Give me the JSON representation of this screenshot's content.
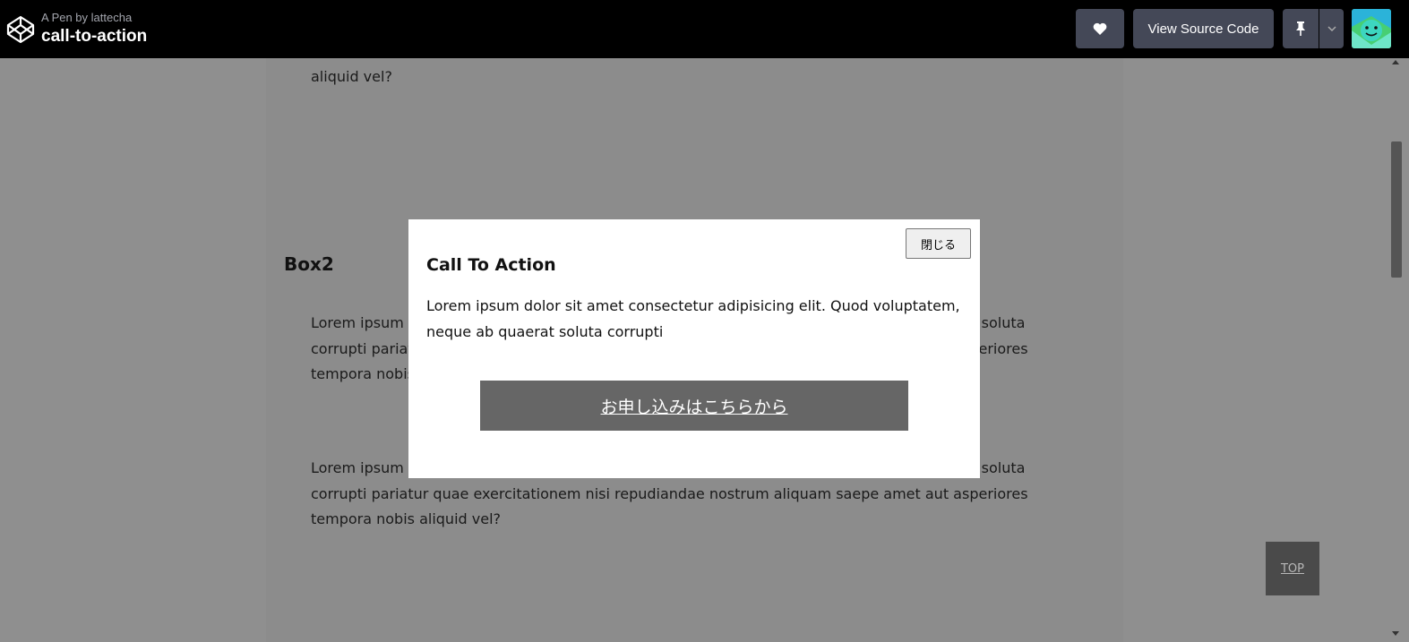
{
  "header": {
    "pen_by": "A Pen by lattecha",
    "pen_title": "call-to-action",
    "view_source_label": "View Source Code"
  },
  "content": {
    "top_para": "aliquid vel?",
    "box2_heading": "Box2",
    "para1": "Lorem ipsum dolor sit amet consectetur adipisicing elit. Quod voluptatem, neque ab quaerat soluta corrupti pariatur quae exercitationem nisi repudiandae nostrum aliquam saepe amet aut asperiores tempora nobis aliquid vel?",
    "para2": "Lorem ipsum dolor sit amet consectetur adipisicing elit. Quod voluptatem, neque ab quaerat soluta corrupti pariatur quae exercitationem nisi repudiandae nostrum aliquam saepe amet aut asperiores tempora nobis aliquid vel?"
  },
  "modal": {
    "close_label": "閉じる",
    "title": "Call To Action",
    "text": "Lorem ipsum dolor sit amet consectetur adipisicing elit. Quod voluptatem, neque ab quaerat soluta corrupti",
    "cta_label": "お申し込みはこちらから"
  },
  "top_button": {
    "label": "TOP"
  },
  "colors": {
    "topbar": "#000000",
    "button_bg": "#444857",
    "overlay_bg": "#8f8f8f",
    "cta_bg": "#666666",
    "top_btn_bg": "#4a4a4a"
  }
}
